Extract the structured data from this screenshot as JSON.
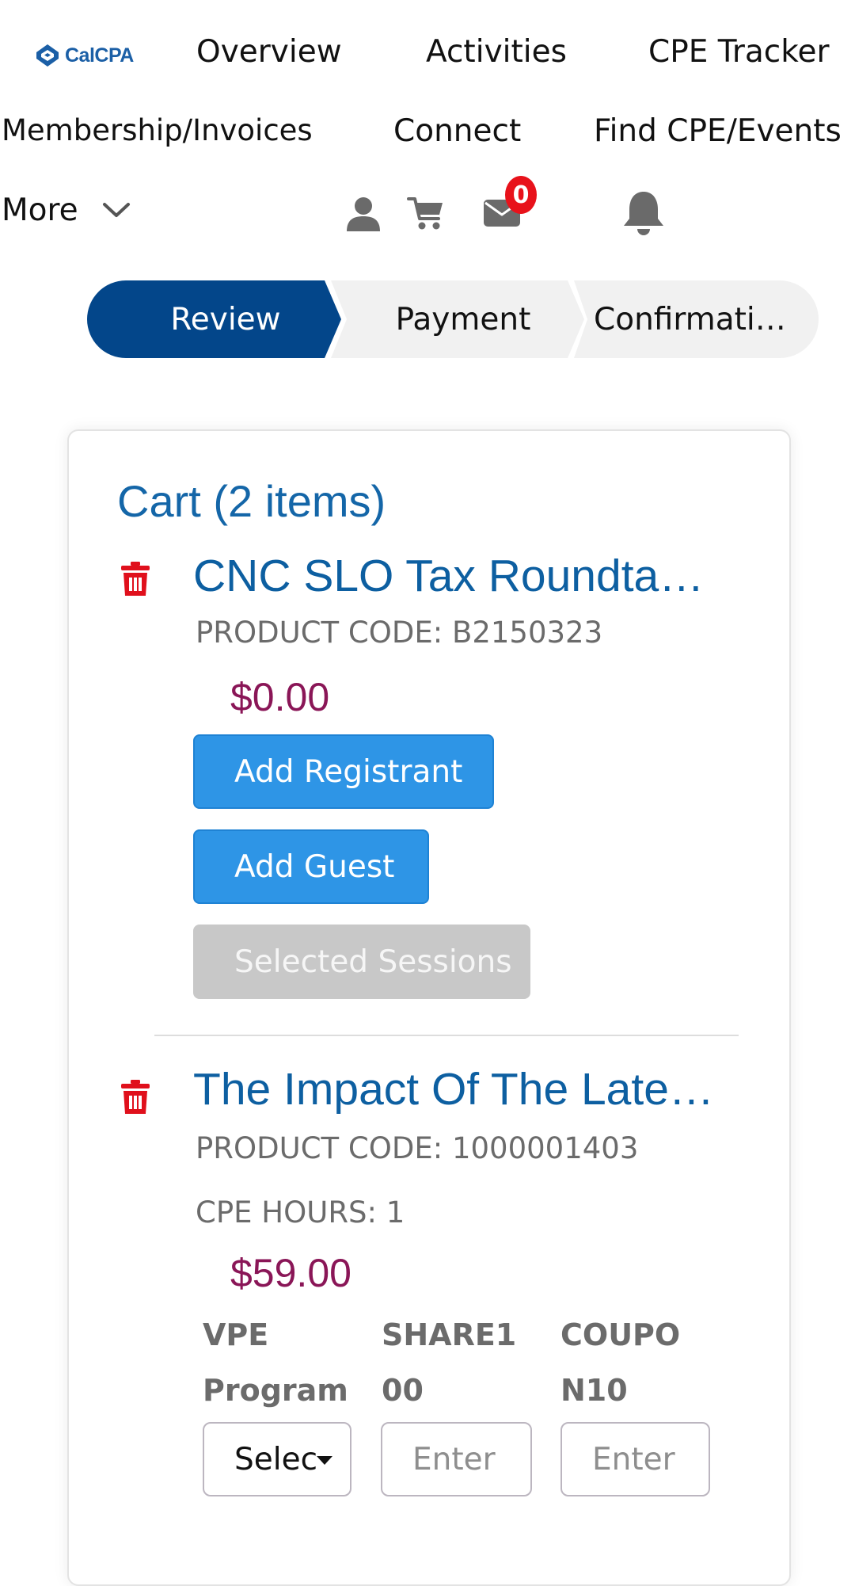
{
  "nav": {
    "logo_text": "CalCPA",
    "links": {
      "overview": "Overview",
      "activities": "Activities",
      "cpe_tracker": "CPE Tracker",
      "membership": "Membership/Invoices",
      "connect": "Connect",
      "find_cpe": "Find CPE/Events",
      "more": "More"
    },
    "messages_count": "0",
    "icons": [
      "user-icon",
      "cart-icon",
      "envelope-icon",
      "bell-icon",
      "chevron-down-icon"
    ]
  },
  "stepper": {
    "steps": [
      {
        "label": "Review",
        "active": true
      },
      {
        "label": "Payment",
        "active": false
      },
      {
        "label": "Confirmati…",
        "active": false
      }
    ]
  },
  "cart": {
    "title": "Cart (2 items)",
    "items": [
      {
        "title": "CNC SLO Tax Roundta…",
        "product_code": "PRODUCT CODE: B2150323",
        "price": "$0.00",
        "buttons": {
          "add_registrant": "Add Registrant",
          "add_guest": "Add Guest",
          "selected_sessions": "Selected Sessions"
        }
      },
      {
        "title": "The Impact Of The Late…",
        "product_code": "PRODUCT CODE: 1000001403",
        "cpe_hours": "CPE HOURS: 1",
        "price": "$59.00",
        "columns": [
          {
            "line1": "VPE",
            "line2": "Program",
            "control": "select",
            "value": "Selec"
          },
          {
            "line1": "SHARE1",
            "line2": "00",
            "control": "input",
            "placeholder": "Enter"
          },
          {
            "line1": "COUPO",
            "line2": "N10",
            "control": "input",
            "placeholder": "Enter"
          }
        ]
      }
    ]
  },
  "colors": {
    "brand_blue": "#0d5fa1",
    "step_active": "#03468a",
    "button_blue": "#2e95e6",
    "price": "#8a1657",
    "trash_red": "#e0101c",
    "badge_red": "#e8121b"
  }
}
